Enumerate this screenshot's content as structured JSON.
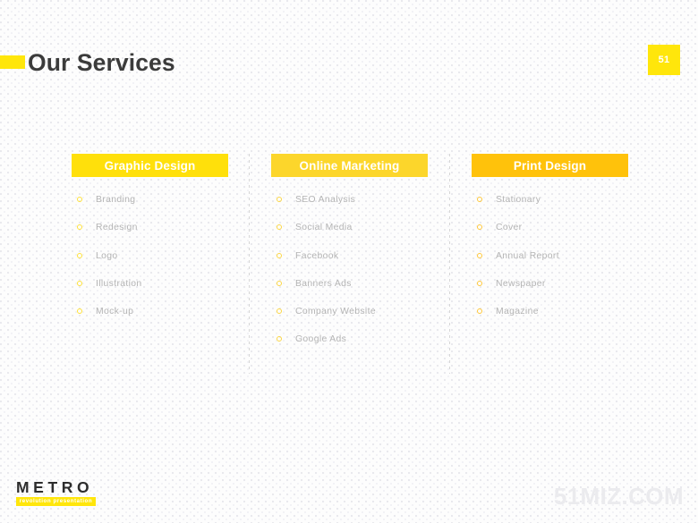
{
  "header": {
    "title": "Our Services",
    "page_number": "51",
    "accent_color": "#ffe60b",
    "title_color": "#3b3b3b"
  },
  "columns": [
    {
      "header": "Graphic Design",
      "header_color": "#ffe00b",
      "bullet_color": "#ffe23a",
      "items": [
        {
          "label": "Branding"
        },
        {
          "label": "Redesign"
        },
        {
          "label": "Logo"
        },
        {
          "label": "Illustration"
        },
        {
          "label": "Mock-up"
        }
      ]
    },
    {
      "header": "Online Marketing",
      "header_color": "#fcd62b",
      "bullet_color": "#fcd744",
      "items": [
        {
          "label": "SEO Analysis"
        },
        {
          "label": "Social Media"
        },
        {
          "label": "Facebook"
        },
        {
          "label": "Banners Ads"
        },
        {
          "label": "Company Website"
        },
        {
          "label": "Google Ads"
        }
      ]
    },
    {
      "header": "Print Design",
      "header_color": "#ffc20b",
      "bullet_color": "#ffc83a",
      "items": [
        {
          "label": "Stationary"
        },
        {
          "label": "Cover"
        },
        {
          "label": "Annual Report"
        },
        {
          "label": "Newspaper"
        },
        {
          "label": "Magazine"
        }
      ]
    }
  ],
  "footer": {
    "logo_name": "METRO",
    "logo_tagline": "revolution presentation",
    "watermark": "51MIZ.COM"
  }
}
